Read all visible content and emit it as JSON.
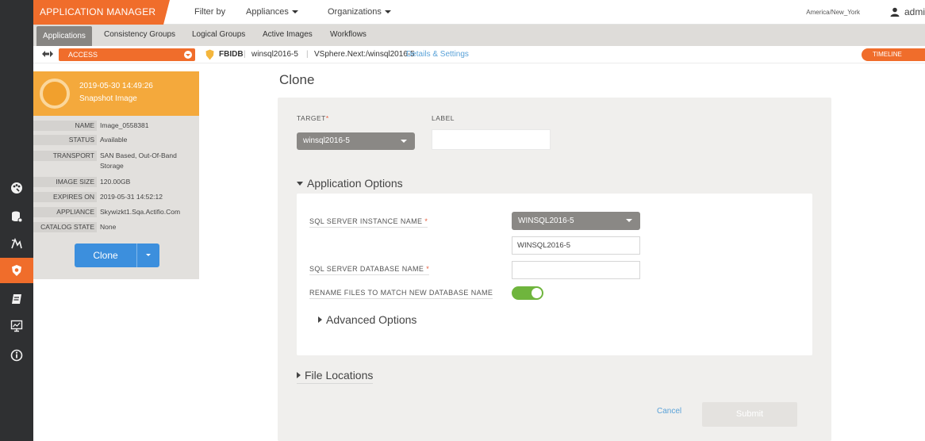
{
  "topbar": {
    "brand": "APPLICATION MANAGER",
    "filter_by": "Filter by",
    "appliances": "Appliances",
    "organizations": "Organizations",
    "timezone": "America/New_York",
    "user": "admi"
  },
  "tabs": [
    {
      "label": "Applications",
      "active": true
    },
    {
      "label": "Consistency Groups"
    },
    {
      "label": "Logical Groups"
    },
    {
      "label": "Active Images"
    },
    {
      "label": "Workflows"
    }
  ],
  "context": {
    "mode": "ACCESS",
    "app_name": "FBIDB",
    "host": "winsql2016-5",
    "path": "VSphere.Next:/winsql2016-5",
    "details_link": "Details & Settings",
    "timeline": "TIMELINE"
  },
  "snapshot": {
    "datetime": "2019-05-30  14:49:26",
    "type": "Snapshot Image",
    "fields": [
      {
        "label": "NAME",
        "value": "Image_0558381"
      },
      {
        "label": "STATUS",
        "value": "Available"
      },
      {
        "label": "TRANSPORT",
        "value": "SAN Based, Out-Of-Band Storage"
      },
      {
        "label": "IMAGE SIZE",
        "value": "120.00GB"
      },
      {
        "label": "EXPIRES ON",
        "value": "2019-05-31 14:52:12"
      },
      {
        "label": "APPLIANCE",
        "value": "Skywizkt1.Sqa.Actifio.Com"
      },
      {
        "label": "CATALOG STATE",
        "value": "None"
      }
    ],
    "clone_button": "Clone"
  },
  "form": {
    "title": "Clone",
    "target_label": "TARGET",
    "target_value": "winsql2016-5",
    "label_label": "LABEL",
    "label_value": "",
    "application_options": "Application Options",
    "sql_instance_label": "SQL SERVER INSTANCE NAME",
    "sql_instance_select": "WINSQL2016-5",
    "sql_instance_input": "WINSQL2016-5",
    "sql_db_label": "SQL SERVER DATABASE NAME",
    "sql_db_value": "",
    "rename_label": "RENAME FILES TO MATCH NEW DATABASE NAME",
    "rename_enabled": true,
    "advanced_options": "Advanced Options",
    "file_locations": "File Locations",
    "cancel": "Cancel",
    "submit": "Submit",
    "required_mark": "*"
  },
  "colors": {
    "accent": "#f06d2b",
    "snapshot_header": "#f4a93c",
    "primary_button": "#3c8fdd",
    "toggle_on": "#6fb53d",
    "link": "#5aa2d8",
    "rail": "#2f3032"
  },
  "rail_icons": [
    "dashboard-icon",
    "data-icon",
    "workflow-icon",
    "app-manager-icon",
    "report-icon",
    "monitor-icon",
    "info-icon"
  ]
}
